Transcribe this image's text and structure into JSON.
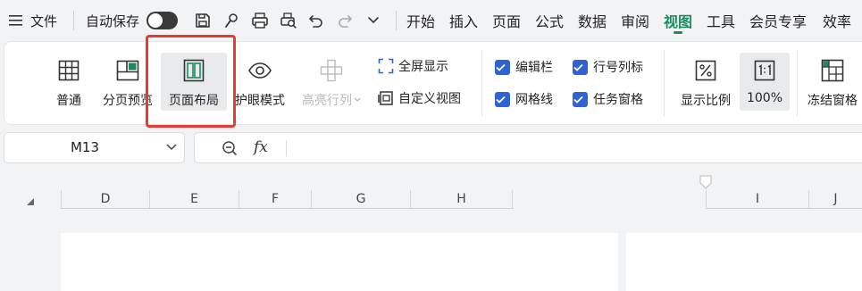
{
  "menubar": {
    "file": "文件",
    "autosave": "自动保存",
    "tabs": [
      "开始",
      "插入",
      "页面",
      "公式",
      "数据",
      "审阅",
      "视图",
      "工具",
      "会员专享",
      "效率"
    ]
  },
  "ribbon": {
    "normal": "普通",
    "page_break_preview": "分页预览",
    "page_layout": "页面布局",
    "eye_protect": "护眼模式",
    "highlight_row_col": "高亮行列",
    "fullscreen": "全屏显示",
    "custom_view": "自定义视图",
    "edit_bar": "编辑栏",
    "gridlines": "网格线",
    "row_col_headers": "行号列标",
    "task_pane": "任务窗格",
    "zoom_ratio": "显示比例",
    "zoom_100": "100%",
    "freeze": "冻结窗格"
  },
  "formula": {
    "cell_ref": "M13",
    "fx": "fx"
  },
  "sheet": {
    "columns": [
      "D",
      "E",
      "F",
      "G",
      "H",
      "I",
      "J"
    ]
  },
  "colors": {
    "accent": "#1d8a5f",
    "checkbox": "#2e63d6",
    "highlight_box": "#e53a35"
  }
}
